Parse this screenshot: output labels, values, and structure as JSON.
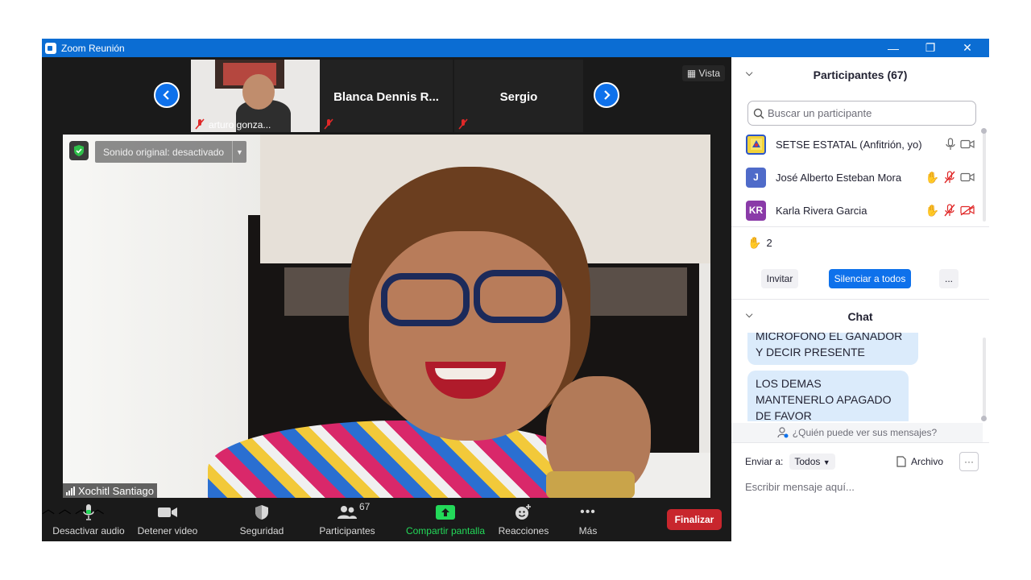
{
  "window": {
    "title": "Zoom Reunión"
  },
  "titlebar_buttons": [
    "—",
    "❐",
    "✕"
  ],
  "strip": {
    "tiles": [
      {
        "name": "arturo gonza..."
      },
      {
        "name": "Blanca Dennis R..."
      },
      {
        "name": "Sergio"
      }
    ],
    "prev_icon": "chevron-left-icon",
    "next_icon": "chevron-right-icon",
    "view_label": "Vista"
  },
  "main_video": {
    "sound_label": "Sonido original: desactivado",
    "speaker_name": "Xochitl Santiago"
  },
  "toolbar": {
    "audio_label": "Desactivar audio",
    "video_label": "Detener video",
    "security_label": "Seguridad",
    "participants_label": "Participantes",
    "participants_count": "67",
    "share_label": "Compartir pantalla",
    "reactions_label": "Reacciones",
    "more_label": "Más",
    "end_label": "Finalizar",
    "share_color": "#23d959",
    "end_color": "#c8262d"
  },
  "participants_panel": {
    "title": "Participantes (67)",
    "search_placeholder": "Buscar un participante",
    "participants": [
      {
        "name": "SETSE ESTATAL (Anfitrión, yo)",
        "initials": "",
        "avatar_color": "#f2d23a",
        "hand": "",
        "mic": "mic-icon",
        "video": "video-icon"
      },
      {
        "name": "José Alberto Esteban Mora",
        "initials": "J",
        "avatar_color": "#4f6bc9",
        "hand": "✋",
        "mic": "mic-muted-icon",
        "video": "video-icon"
      },
      {
        "name": "Karla Rivera Garcia",
        "initials": "KR",
        "avatar_color": "#8a3aa8",
        "hand": "✋",
        "mic": "mic-muted-icon",
        "video": "video-off-icon"
      }
    ],
    "raised_hands_count": "2",
    "invite_label": "Invitar",
    "mute_all_label": "Silenciar a todos",
    "more_label": "..."
  },
  "chat": {
    "title": "Chat",
    "messages": [
      "MICROFONO EL GANADOR Y DECIR PRESENTE",
      "LOS DEMAS MANTENERLO APAGADO DE FAVOR"
    ],
    "who_can_see": "¿Quién puede ver sus mensajes?",
    "send_to_label": "Enviar a:",
    "send_to_value": "Todos",
    "file_label": "Archivo",
    "more_label": "···",
    "input_placeholder": "Escribir mensaje aquí..."
  }
}
